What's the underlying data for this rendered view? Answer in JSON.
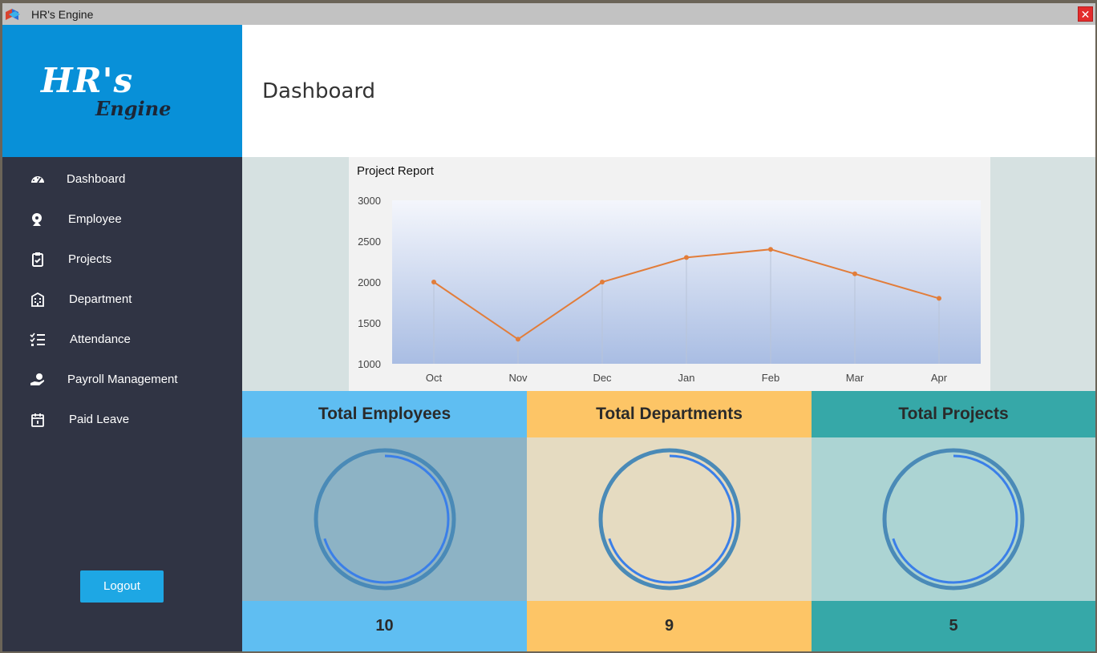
{
  "window": {
    "title": "HR's Engine",
    "close_glyph": "✕"
  },
  "logo": {
    "line1": "HR's",
    "line2": "Engine"
  },
  "header": {
    "title": "Dashboard"
  },
  "sidebar": {
    "items": [
      {
        "label": "Dashboard",
        "icon": "speedometer-icon"
      },
      {
        "label": "Employee",
        "icon": "employee-icon"
      },
      {
        "label": "Projects",
        "icon": "clipboard-icon"
      },
      {
        "label": "Department",
        "icon": "building-icon"
      },
      {
        "label": "Attendance",
        "icon": "checklist-icon"
      },
      {
        "label": "Payroll Management",
        "icon": "hand-coin-icon"
      },
      {
        "label": "Paid Leave",
        "icon": "calendar-icon"
      }
    ],
    "logout_label": "Logout"
  },
  "chart_data": {
    "type": "line",
    "title": "Project Report",
    "categories": [
      "Oct",
      "Nov",
      "Dec",
      "Jan",
      "Feb",
      "Mar",
      "Apr"
    ],
    "series": [
      {
        "values": [
          2000,
          1300,
          2000,
          2300,
          2400,
          2100,
          1800
        ],
        "color": "#e27d3a"
      }
    ],
    "ylim": [
      1000,
      3000
    ],
    "yticks": [
      3000,
      2500,
      2000,
      1500,
      1000
    ],
    "grid": "vertical",
    "xlabel": "",
    "ylabel": ""
  },
  "cards": [
    {
      "title": "Total Employees",
      "value": "10",
      "head_color": "#5fbef2",
      "body_color": "#8db3c5",
      "progress": 0.7
    },
    {
      "title": "Total Departments",
      "value": "9",
      "head_color": "#fdc566",
      "body_color": "#e5dbc1",
      "progress": 0.7
    },
    {
      "title": "Total Projects",
      "value": "5",
      "head_color": "#36a8a8",
      "body_color": "#acd4d3",
      "progress": 0.7
    }
  ]
}
